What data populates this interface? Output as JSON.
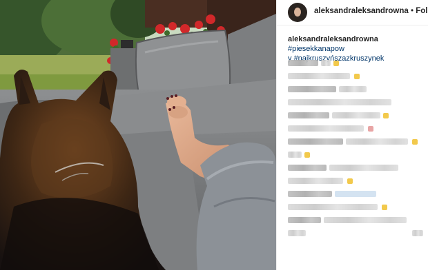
{
  "header": {
    "username": "aleksandraleksandrowna",
    "separator": "•",
    "follow_label": "Followi"
  },
  "caption": {
    "username": "aleksandraleksandrowna",
    "hashtag_1": "#piesekkanapow",
    "hashtag_1_end": "y",
    "hashtag_2": "#najkruszyńszazkruszynek"
  },
  "colors": {
    "hashtag": "#003569",
    "text": "#262626",
    "blur_accent": "#f2c94c"
  },
  "icons": {
    "avatar": "profile-photo"
  }
}
